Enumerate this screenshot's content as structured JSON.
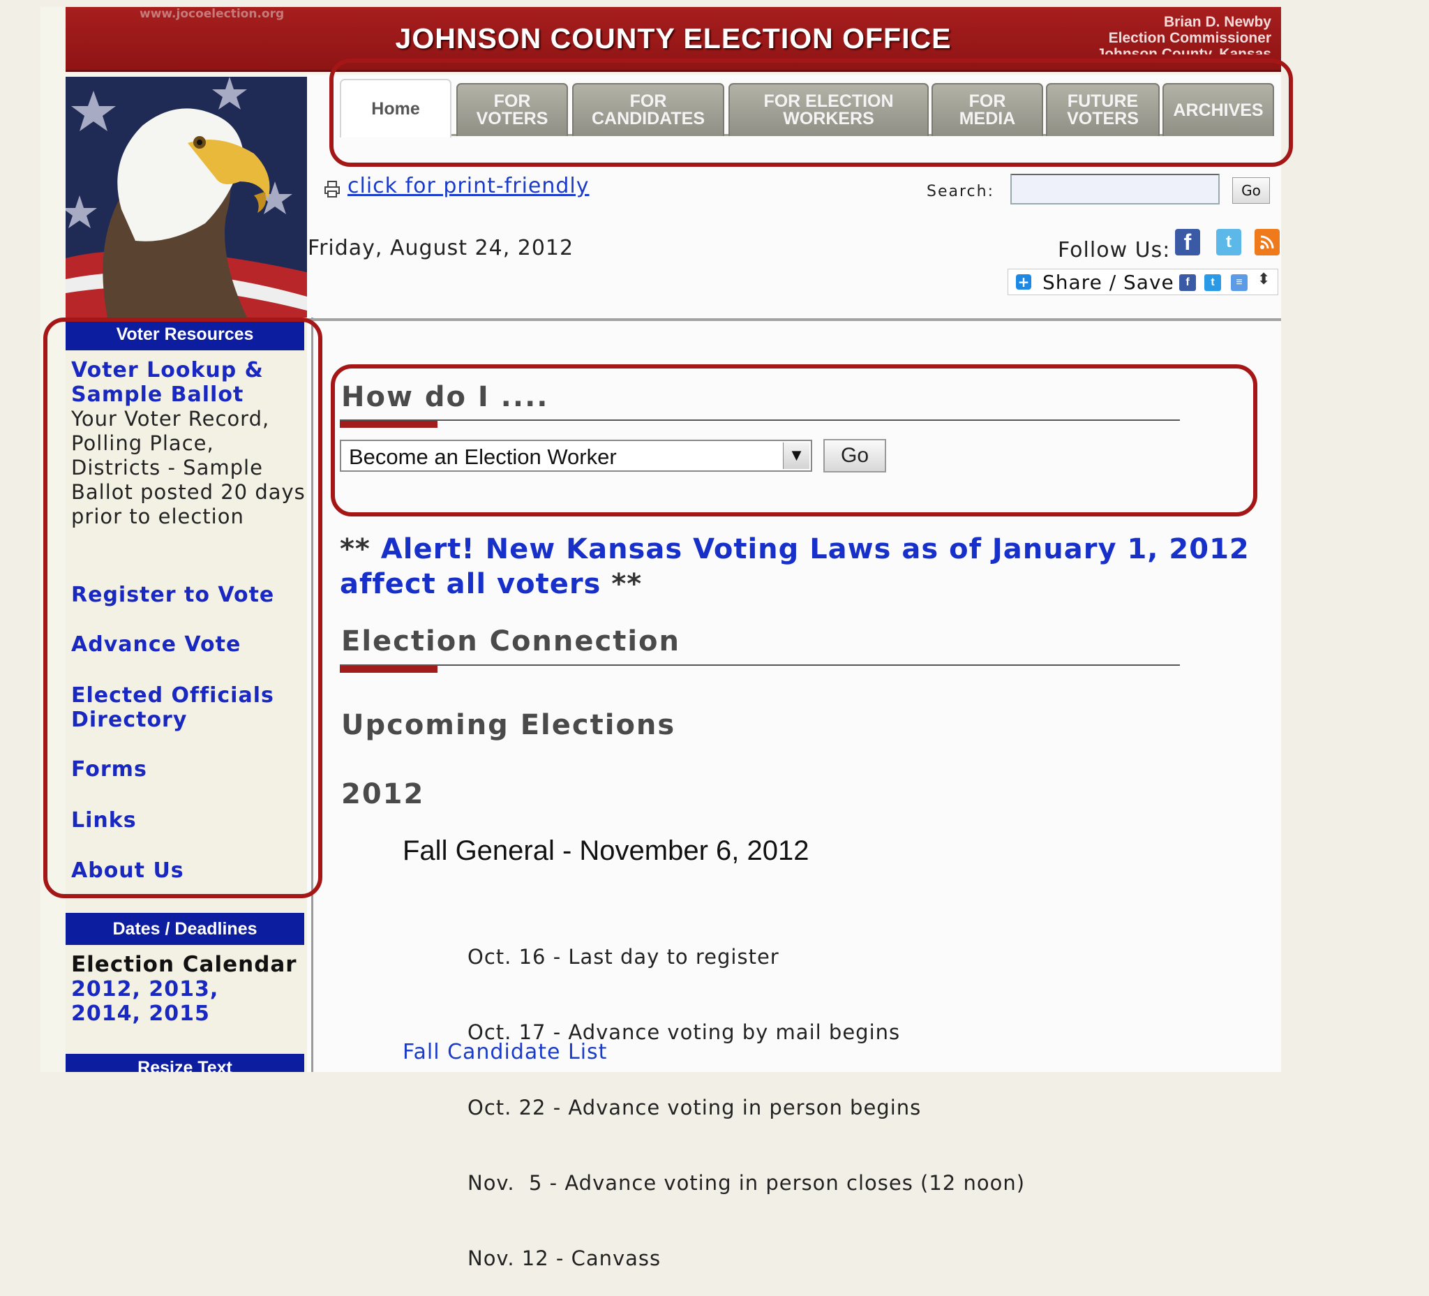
{
  "header": {
    "url_text": "www.jocoelection.org",
    "title": "JOHNSON COUNTY ELECTION OFFICE",
    "commissioner_name": "Brian D. Newby",
    "commissioner_title": "Election Commissioner",
    "county": "Johnson County, Kansas"
  },
  "tabs": [
    {
      "label": "Home",
      "active": true
    },
    {
      "label": "FOR VOTERS"
    },
    {
      "label": "FOR CANDIDATES"
    },
    {
      "label": "FOR ELECTION WORKERS"
    },
    {
      "label": "FOR MEDIA"
    },
    {
      "label": "FUTURE VOTERS"
    },
    {
      "label": "ARCHIVES"
    }
  ],
  "toolbar": {
    "print_label": "click for print-friendly",
    "search_label": "Search:",
    "search_value": "",
    "search_go": "Go"
  },
  "date": "Friday, August 24, 2012",
  "follow": {
    "label": "Follow Us:",
    "icons": [
      "facebook-icon",
      "twitter-icon",
      "rss-icon"
    ]
  },
  "share": {
    "label": "Share / Save"
  },
  "sidebar": {
    "voter_resources_header": "Voter Resources",
    "voter_lookup_label": "Voter Lookup & Sample Ballot",
    "voter_lookup_desc": "Your Voter Record, Polling Place, Districts - Sample Ballot posted 20 days prior to election",
    "links": [
      "Register to Vote",
      "Advance Vote",
      "Elected Officials Directory",
      "Forms",
      "Links",
      "About Us"
    ],
    "dates_header": "Dates / Deadlines",
    "election_calendar_label": "Election Calendar",
    "calendar_years": "2012, 2013, 2014, 2015",
    "resize_header": "Resize Text"
  },
  "main": {
    "howdo_title": "How do I ....",
    "howdo_selected": "Become an Election Worker",
    "howdo_go": "Go",
    "alert_stars_open": "**",
    "alert_text": "Alert! New Kansas Voting Laws as of January 1, 2012 affect all voters",
    "alert_stars_close": "**",
    "election_connection_title": "Election Connection",
    "upcoming_title": "Upcoming Elections",
    "year": "2012",
    "fall_title": "Fall General - November 6, 2012",
    "calendar_items": [
      "Oct. 16 - Last day to register",
      "Oct. 17 - Advance voting by mail begins",
      "Oct. 22 - Advance voting in person begins",
      "Nov.  5 - Advance voting in person closes (12 noon)",
      "Nov. 12 - Canvass"
    ],
    "candidate_list_label": "Fall Candidate List"
  },
  "colors": {
    "header_red": "#a71e1e",
    "sidebar_blue": "#0d1da0",
    "link_blue": "#1928c0",
    "annotation_red": "#a51616"
  }
}
